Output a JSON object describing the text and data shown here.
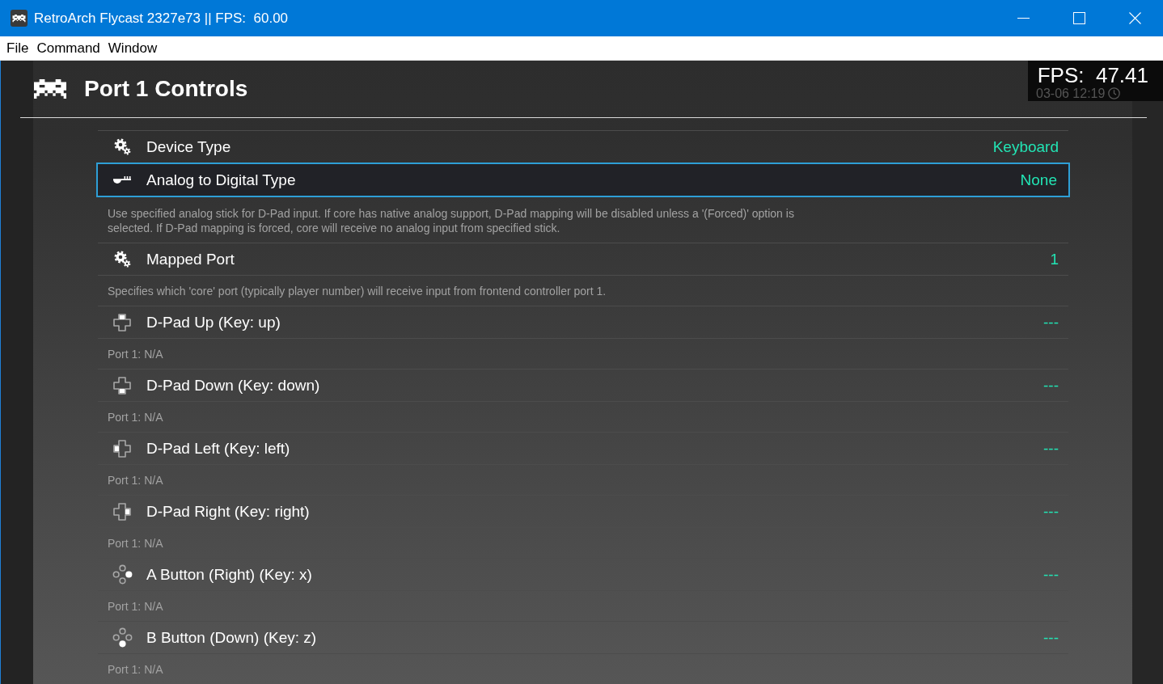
{
  "window": {
    "title": "RetroArch Flycast 2327e73 || FPS:  60.00"
  },
  "menu_bar": [
    "File",
    "Command",
    "Window"
  ],
  "header": {
    "title": "Port 1 Controls"
  },
  "overlay": {
    "clock": "03-06 12:19",
    "fps": "FPS:  47.41"
  },
  "settings": [
    {
      "kind": "gears",
      "label": "Device Type",
      "value": "Keyboard",
      "selected": false
    },
    {
      "kind": "stick",
      "label": "Analog to Digital Type",
      "value": "None",
      "selected": true,
      "description": "Use specified analog stick for D-Pad input. If core has native analog support, D-Pad mapping will be disabled unless a '(Forced)' option is selected. If D-Pad mapping is forced, core will receive no analog input from specified stick."
    },
    {
      "kind": "gears",
      "label": "Mapped Port",
      "value": "1",
      "selected": false,
      "description": "Specifies which 'core' port (typically player number) will receive input from frontend controller port 1."
    },
    {
      "kind": "dpadup",
      "label": "D-Pad Up (Key: up)",
      "value": "---",
      "selected": false,
      "description": "Port 1: N/A"
    },
    {
      "kind": "dpaddown",
      "label": "D-Pad Down (Key: down)",
      "value": "---",
      "selected": false,
      "description": "Port 1: N/A"
    },
    {
      "kind": "dpadleft",
      "label": "D-Pad Left (Key: left)",
      "value": "---",
      "selected": false,
      "description": "Port 1: N/A"
    },
    {
      "kind": "dpadright",
      "label": "D-Pad Right (Key: right)",
      "value": "---",
      "selected": false,
      "description": "Port 1: N/A"
    },
    {
      "kind": "buttonright",
      "label": "A Button (Right) (Key: x)",
      "value": "---",
      "selected": false,
      "description": "Port 1: N/A"
    },
    {
      "kind": "buttondown",
      "label": "B Button (Down) (Key: z)",
      "value": "---",
      "selected": false,
      "description": "Port 1: N/A"
    }
  ]
}
